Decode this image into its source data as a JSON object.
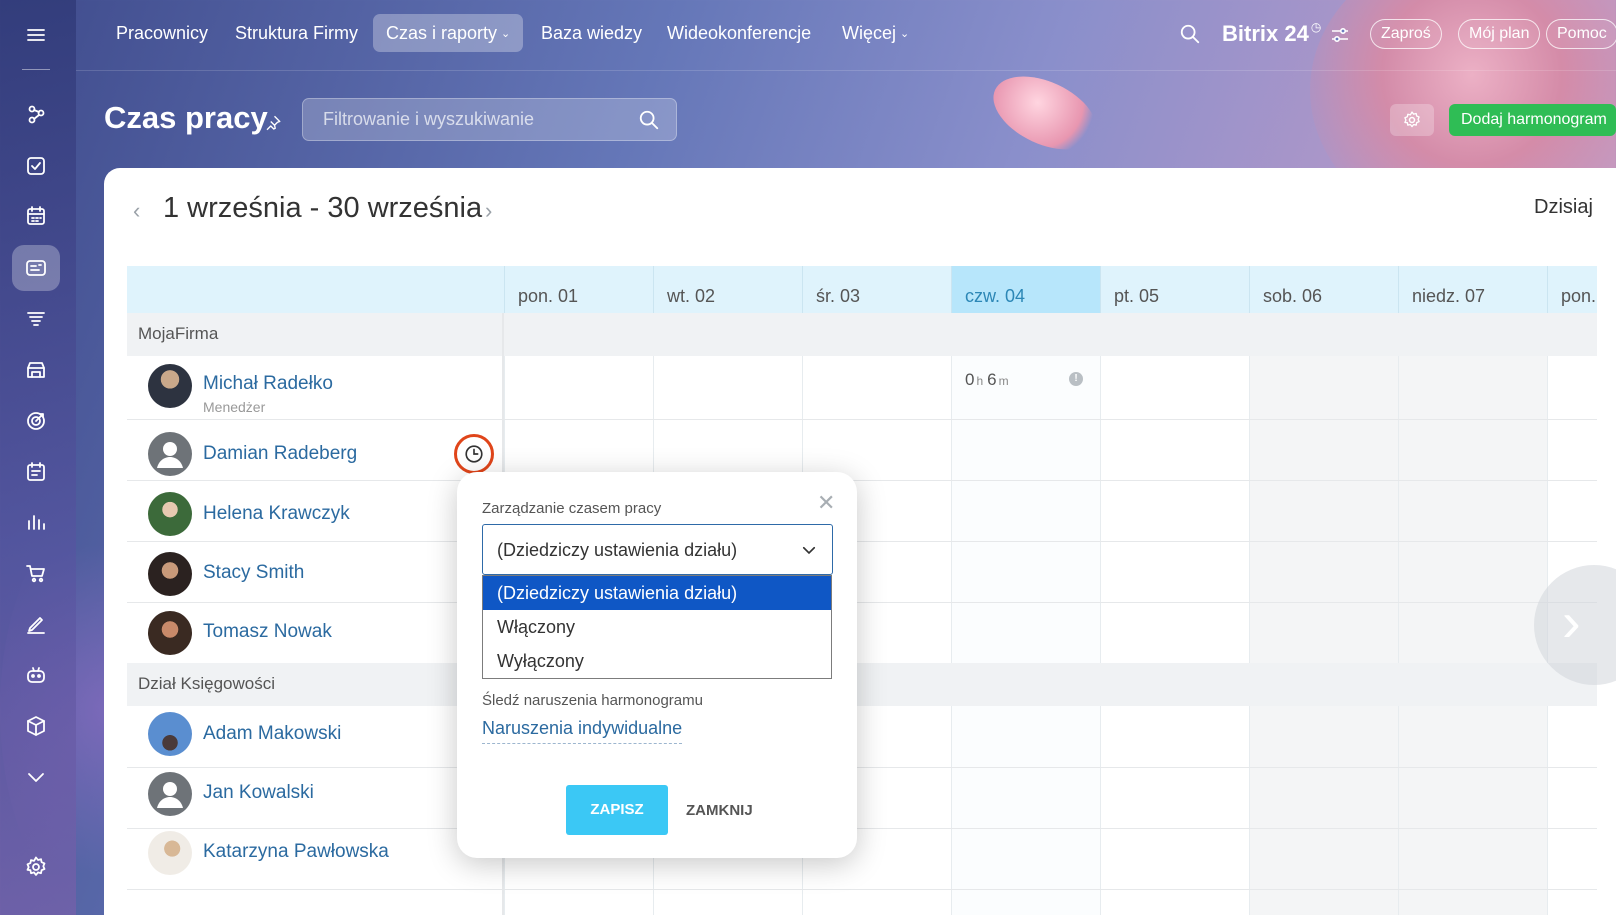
{
  "topnav": {
    "items": [
      {
        "label": "Pracownicy"
      },
      {
        "label": "Struktura Firmy"
      },
      {
        "label": "Czas i raporty"
      },
      {
        "label": "Baza wiedzy"
      },
      {
        "label": "Wideokonferencje"
      },
      {
        "label": "Więcej"
      }
    ],
    "brand": "Bitrix 24",
    "invite_label": "Zaproś",
    "plan_label": "Mój plan",
    "help_label": "Pomoc"
  },
  "sidebar": {
    "icons": [
      "menu-icon",
      "feed-icon",
      "tasks-icon",
      "calendar-icon",
      "timeman-icon",
      "crm-icon",
      "store-icon",
      "goals-icon",
      "schedule-icon",
      "analytics-icon",
      "shop-icon",
      "sign-icon",
      "bot-icon",
      "box-icon",
      "more-icon",
      "settings-icon"
    ]
  },
  "header": {
    "title": "Czas pracy",
    "search_placeholder": "Filtrowanie i wyszukiwanie",
    "add_button": "Dodaj harmonogram"
  },
  "period": {
    "label": "1 września - 30 września",
    "today_label": "Dzisiaj"
  },
  "days": [
    {
      "label": "pon. 01"
    },
    {
      "label": "wt. 02"
    },
    {
      "label": "śr. 03"
    },
    {
      "label": "czw. 04"
    },
    {
      "label": "pt. 05"
    },
    {
      "label": "sob. 06"
    },
    {
      "label": "niedz. 07"
    },
    {
      "label": "pon."
    }
  ],
  "groups": [
    {
      "name": "MojaFirma",
      "people": [
        {
          "name": "Michał Radełko",
          "position": "Menedżer"
        },
        {
          "name": "Damian Radeberg",
          "position": ""
        },
        {
          "name": "Helena Krawczyk",
          "position": ""
        },
        {
          "name": "Stacy Smith",
          "position": ""
        },
        {
          "name": "Tomasz Nowak",
          "position": ""
        }
      ]
    },
    {
      "name": "Dział Księgowości",
      "people": [
        {
          "name": "Adam Makowski",
          "position": ""
        },
        {
          "name": "Jan Kowalski",
          "position": ""
        },
        {
          "name": "Katarzyna Pawłowska",
          "position": ""
        }
      ]
    }
  ],
  "worktime_entry": {
    "hours": "0",
    "hours_unit": "h",
    "minutes": "6",
    "minutes_unit": "m"
  },
  "popup": {
    "label_management": "Zarządzanie czasem pracy",
    "selected_value": "(Dziedziczy ustawienia działu)",
    "options": [
      "(Dziedziczy ustawienia działu)",
      "Włączony",
      "Wyłączony"
    ],
    "label_violations": "Śledź naruszenia harmonogramu",
    "violations_link": "Naruszenia indywidualne",
    "save_label": "ZAPISZ",
    "close_label": "ZAMKNIJ"
  },
  "colors": {
    "accent_green": "#2fbd55",
    "save_blue": "#3bc8f5",
    "link_blue": "#2b6aa0",
    "today_header": "#b7e6fb",
    "highlight_ring": "#e0451a",
    "option_selected": "#0f57c5"
  }
}
